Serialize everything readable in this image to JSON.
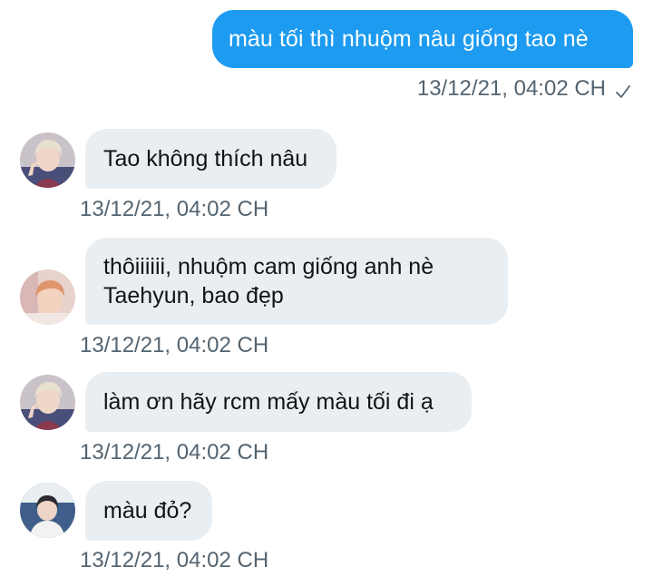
{
  "outgoing": {
    "text": "màu tối thì nhuộm nâu giống tao nè",
    "timestamp": "13/12/21, 04:02 CH",
    "status_icon": "sent-check-icon"
  },
  "incoming": [
    {
      "text": "Tao không thích nâu",
      "timestamp": "13/12/21, 04:02 CH",
      "avatar": "blond-hair-peace-sign-avatar"
    },
    {
      "lines": [
        "thôiiiiii, nhuộm cam giống anh nè",
        "Taehyun, bao đẹp"
      ],
      "timestamp": "13/12/21, 04:02 CH",
      "avatar": "orange-hair-avatar"
    },
    {
      "text": "làm ơn hãy rcm mấy màu tối đi ạ",
      "timestamp": "13/12/21, 04:02 CH",
      "avatar": "blond-hair-peace-sign-avatar"
    },
    {
      "text": "màu đỏ?",
      "timestamp": "13/12/21, 04:02 CH",
      "avatar": "dark-hair-avatar"
    }
  ],
  "colors": {
    "outgoing_bubble": "#1d9bf0",
    "incoming_bubble": "#e9eef2",
    "meta_text": "#536471"
  }
}
